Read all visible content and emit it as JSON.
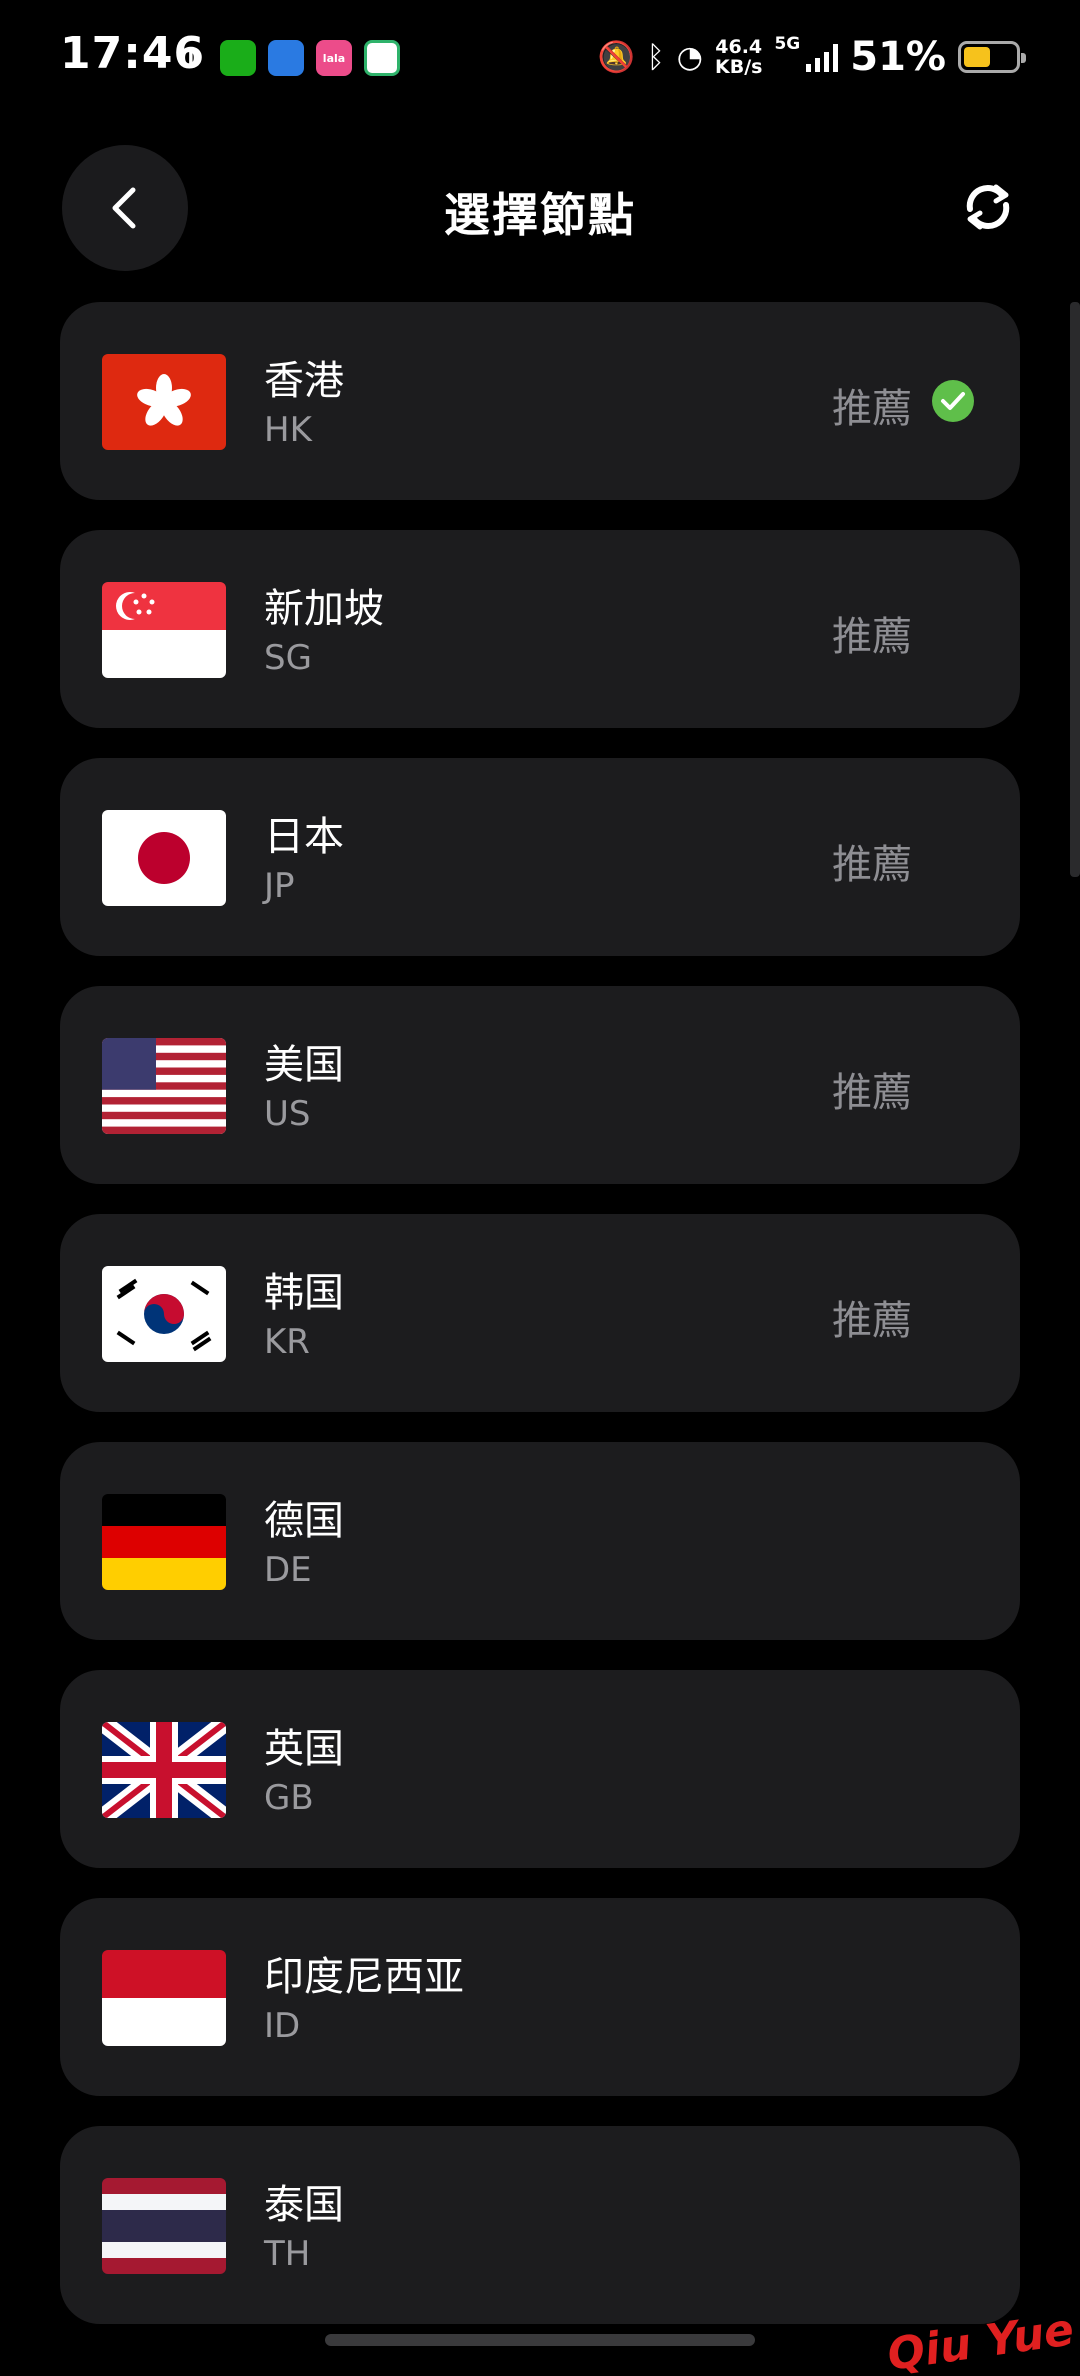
{
  "status_bar": {
    "time": "17:46",
    "speed_value": "46.4",
    "speed_unit": "KB/s",
    "network": "5G",
    "battery": "51%",
    "battery_level": 0.51
  },
  "header": {
    "title": "選擇節點"
  },
  "nodes": [
    {
      "name": "香港",
      "code": "HK",
      "tag": "推薦",
      "selected": true,
      "flag": "hk-flag"
    },
    {
      "name": "新加坡",
      "code": "SG",
      "tag": "推薦",
      "selected": false,
      "flag": "sg-flag"
    },
    {
      "name": "日本",
      "code": "JP",
      "tag": "推薦",
      "selected": false,
      "flag": "jp-flag"
    },
    {
      "name": "美国",
      "code": "US",
      "tag": "推薦",
      "selected": false,
      "flag": "us-flag"
    },
    {
      "name": "韩国",
      "code": "KR",
      "tag": "推薦",
      "selected": false,
      "flag": "kr-flag"
    },
    {
      "name": "德国",
      "code": "DE",
      "tag": "",
      "selected": false,
      "flag": "de-flag"
    },
    {
      "name": "英国",
      "code": "GB",
      "tag": "",
      "selected": false,
      "flag": "gb-flag"
    },
    {
      "name": "印度尼西亚",
      "code": "ID",
      "tag": "",
      "selected": false,
      "flag": "id-flag"
    },
    {
      "name": "泰国",
      "code": "TH",
      "tag": "",
      "selected": false,
      "flag": "th-flag"
    }
  ],
  "watermark": "Qiu Yue",
  "colors": {
    "background": "#000000",
    "card": "#1c1c1e",
    "check": "#5fbf4a",
    "tag_text": "#8e8e93"
  }
}
